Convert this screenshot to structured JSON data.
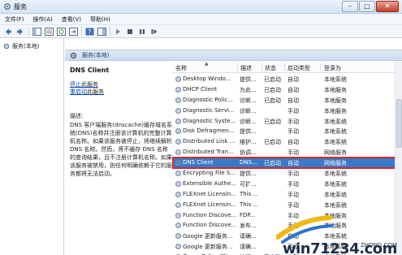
{
  "window": {
    "title": "服务"
  },
  "menu": {
    "items": [
      "文件(F)",
      "操作(A)",
      "查看(V)",
      "帮助(H)"
    ]
  },
  "tree": {
    "item_label": "服务(本地)"
  },
  "pane_header": {
    "label": "服务(本地)"
  },
  "details": {
    "service_name": "DNS Client",
    "stop_link": "停止",
    "stop_suffix": "此服务",
    "restart_link": "重启动",
    "restart_suffix": "此服务",
    "description_label": "描述:",
    "description": "DNS 客户端服务(dnscache)缓存域名系统(DNS)名称并注册该计算机的完整计算机名称。如果该服务被停止，将继续解析 DNS 名称。然而，将不缓存 DNS 名称的查询结果，且不注册计算机名称。如果该服务被禁用，则任何明确依赖于它的服务都将无法启动。"
  },
  "list": {
    "columns": [
      "名称",
      "描述",
      "状态",
      "启动类型",
      "登录为"
    ],
    "selected_index": 6,
    "rows": [
      {
        "name": "Desktop Windo...",
        "desc": "提供...",
        "status": "已启动",
        "start": "自动",
        "logon": "本地系统"
      },
      {
        "name": "DHCP Client",
        "desc": "为此...",
        "status": "已启动",
        "start": "自动",
        "logon": "本地服务"
      },
      {
        "name": "Diagnostic Polic...",
        "desc": "诊断...",
        "status": "已启动",
        "start": "自动",
        "logon": "本地服务"
      },
      {
        "name": "Diagnostic Servi...",
        "desc": "诊断...",
        "status": "",
        "start": "手动",
        "logon": "本地服务"
      },
      {
        "name": "Diagnostic Syste...",
        "desc": "诊断...",
        "status": "已启动",
        "start": "手动",
        "logon": "本地系统"
      },
      {
        "name": "Disk Defragmen...",
        "desc": "提供...",
        "status": "",
        "start": "手动",
        "logon": "本地系统"
      },
      {
        "name": "Distributed Link ...",
        "desc": "维护...",
        "status": "已启动",
        "start": "自动",
        "logon": "本地系统"
      },
      {
        "name": "Distributed Tran...",
        "desc": "协调...",
        "status": "",
        "start": "手动",
        "logon": "网络服务"
      },
      {
        "name": "DNS Client",
        "desc": "DNS...",
        "status": "已启动",
        "start": "自动",
        "logon": "网络服务"
      },
      {
        "name": "Encrypting File S...",
        "desc": "提供...",
        "status": "",
        "start": "手动",
        "logon": "本地系统"
      },
      {
        "name": "Extensible Authe...",
        "desc": "可扩...",
        "status": "",
        "start": "手动",
        "logon": "本地系统"
      },
      {
        "name": "FLEXnet Licensin...",
        "desc": "This ...",
        "status": "",
        "start": "手动",
        "logon": "本地系统"
      },
      {
        "name": "FLEXnet Licensin...",
        "desc": "This ...",
        "status": "",
        "start": "手动",
        "logon": "本地系统"
      },
      {
        "name": "Function Discove...",
        "desc": "FDP...",
        "status": "",
        "start": "手动",
        "logon": "本地服务"
      },
      {
        "name": "Function Discove...",
        "desc": "发布...",
        "status": "",
        "start": "手动",
        "logon": "本地服务"
      },
      {
        "name": "Google 更新服务...",
        "desc": "请确...",
        "status": "",
        "start": "自动",
        "logon": "本地系统"
      },
      {
        "name": "Google 更新服务...",
        "desc": "请确...",
        "status": "",
        "start": "手动",
        "logon": "本地系统"
      },
      {
        "name": "Group Policy Cli...",
        "desc": "该服...",
        "status": "已启动",
        "start": "自动",
        "logon": "本地系统"
      }
    ]
  },
  "watermark": {
    "text": "win71234.com",
    "sub": "ZHONG.COM"
  }
}
